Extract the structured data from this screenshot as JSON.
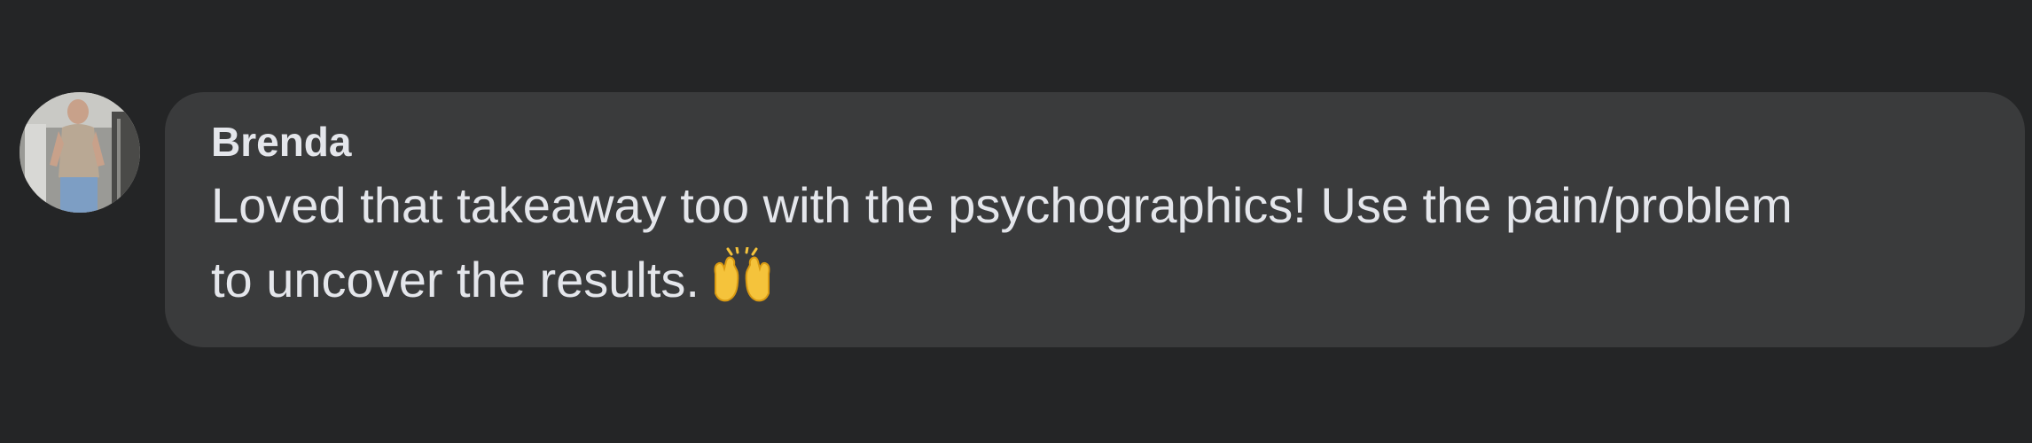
{
  "comment": {
    "author": "Brenda",
    "text": "Loved that takeaway too with the psychographics! Use the pain/problem to uncover the results.",
    "emoji": "raising-hands-emoji"
  },
  "colors": {
    "background": "#242526",
    "bubble": "#3a3b3c",
    "text": "#e4e6eb",
    "emoji": "#f5c33b"
  }
}
